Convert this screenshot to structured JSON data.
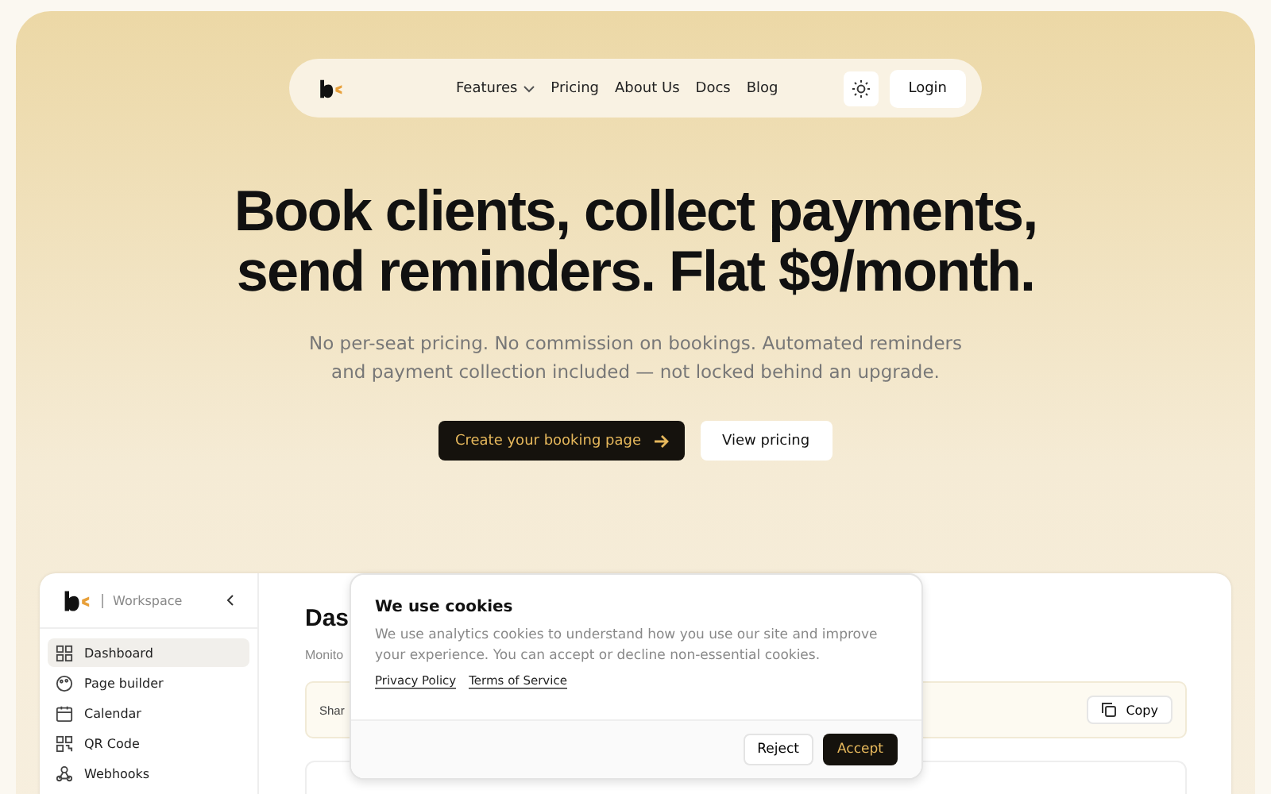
{
  "nav": {
    "links": [
      {
        "label": "Features",
        "dropdown": true
      },
      {
        "label": "Pricing",
        "dropdown": false
      },
      {
        "label": "About Us",
        "dropdown": false
      },
      {
        "label": "Docs",
        "dropdown": false
      },
      {
        "label": "Blog",
        "dropdown": false
      }
    ],
    "login": "Login"
  },
  "hero": {
    "headline": [
      "Book clients, collect payments,",
      "send reminders. Flat $9/month."
    ],
    "subtitle": "No per-seat pricing. No commission on bookings. Automated reminders and payment collection included — not locked behind an upgrade.",
    "primary": "Create your booking page",
    "secondary": "View pricing"
  },
  "app": {
    "workspace": "Workspace",
    "sidebar": [
      {
        "label": "Dashboard",
        "selected": true
      },
      {
        "label": "Page builder",
        "selected": false
      },
      {
        "label": "Calendar",
        "selected": false
      },
      {
        "label": "QR Code",
        "selected": false
      },
      {
        "label": "Webhooks",
        "selected": false
      }
    ],
    "title": "Das",
    "subtitle": "Monito",
    "share_label": "Shar",
    "copy": "Copy"
  },
  "cookies": {
    "title": "We use cookies",
    "text": "We use analytics cookies to understand how you use our site and improve your experience. You can accept or decline non-essential cookies.",
    "links": [
      "Privacy Policy",
      "Terms of Service"
    ],
    "reject": "Reject",
    "accept": "Accept"
  }
}
